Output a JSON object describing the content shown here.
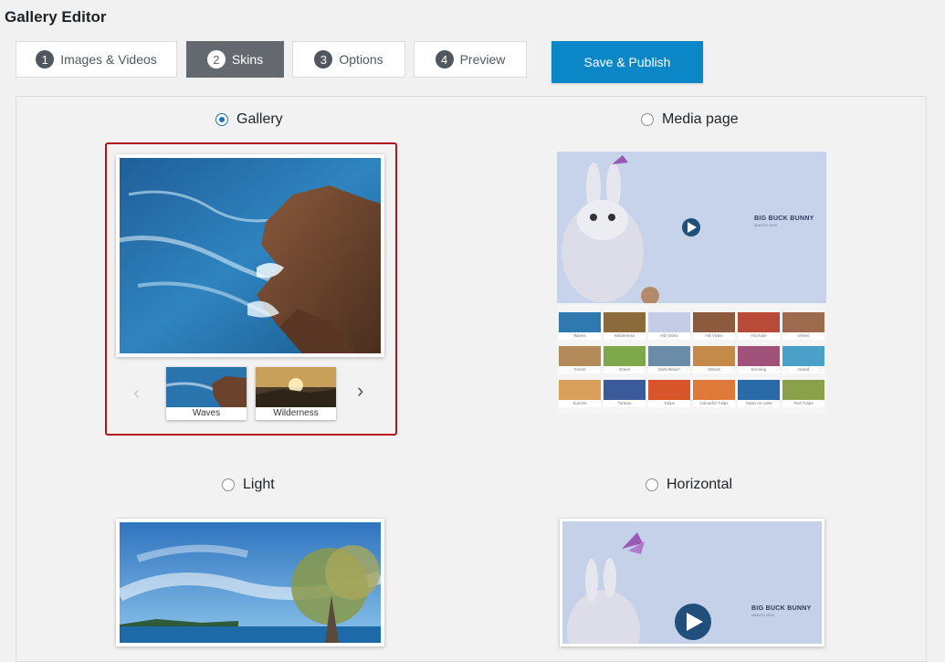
{
  "page": {
    "title": "Gallery Editor"
  },
  "tabs": [
    {
      "num": "1",
      "label": "Images & Videos"
    },
    {
      "num": "2",
      "label": "Skins",
      "active": true
    },
    {
      "num": "3",
      "label": "Options"
    },
    {
      "num": "4",
      "label": "Preview"
    }
  ],
  "publish_label": "Save & Publish",
  "skins": {
    "gallery": {
      "label": "Gallery",
      "selected": true,
      "thumbs": [
        "Waves",
        "Wilderness"
      ]
    },
    "media_page": {
      "label": "Media page",
      "video_title": "BIG BUCK BUNNY",
      "video_sub": "MARCH 2008",
      "grid": [
        "Waves",
        "Wilderness",
        "HD Video",
        "HD Video",
        "YouTube",
        "Vimeo",
        "Forest",
        "Green",
        "Dark Beach",
        "Desert",
        "Evening",
        "Island",
        "Sunrise",
        "Toronto",
        "Tulips",
        "Colourful Tulips",
        "Swan on Lake",
        "Red Tulips"
      ]
    },
    "light": {
      "label": "Light"
    },
    "horizontal": {
      "label": "Horizontal",
      "video_title": "BIG BUCK BUNNY",
      "video_sub": "MARCH 2008"
    }
  },
  "colors": {
    "accent": "#0b86c6",
    "selected_border": "#b3141c",
    "active_tab": "#646970"
  }
}
